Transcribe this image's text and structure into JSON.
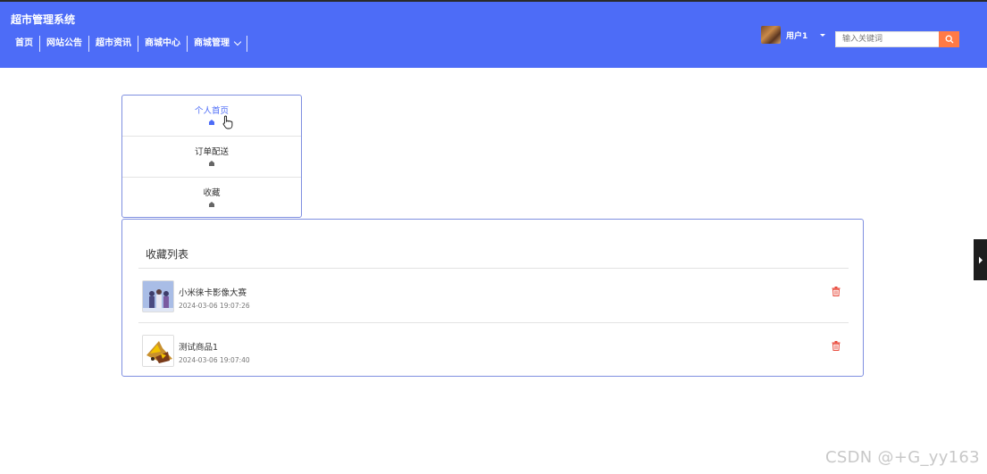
{
  "app": {
    "title": "超市管理系统"
  },
  "nav": {
    "items": [
      {
        "label": "首页"
      },
      {
        "label": "网站公告"
      },
      {
        "label": "超市资讯"
      },
      {
        "label": "商城中心"
      },
      {
        "label": "商城管理"
      }
    ]
  },
  "user": {
    "name": "用户1"
  },
  "search": {
    "placeholder": "输入关键词"
  },
  "sidebar": {
    "tabs": [
      {
        "label": "个人首页",
        "active": true
      },
      {
        "label": "订单配送",
        "active": false
      },
      {
        "label": "收藏",
        "active": false
      }
    ]
  },
  "favorites": {
    "title": "收藏列表",
    "items": [
      {
        "name": "小米徕卡影像大赛",
        "time": "2024-03-06 19:07:26"
      },
      {
        "name": "测试商品1",
        "time": "2024-03-06 19:07:40"
      }
    ]
  },
  "colors": {
    "header": "#4d6cf7",
    "accent": "#ff7a45",
    "delete": "#e84a3c"
  },
  "watermark": "CSDN @+G_yy163"
}
